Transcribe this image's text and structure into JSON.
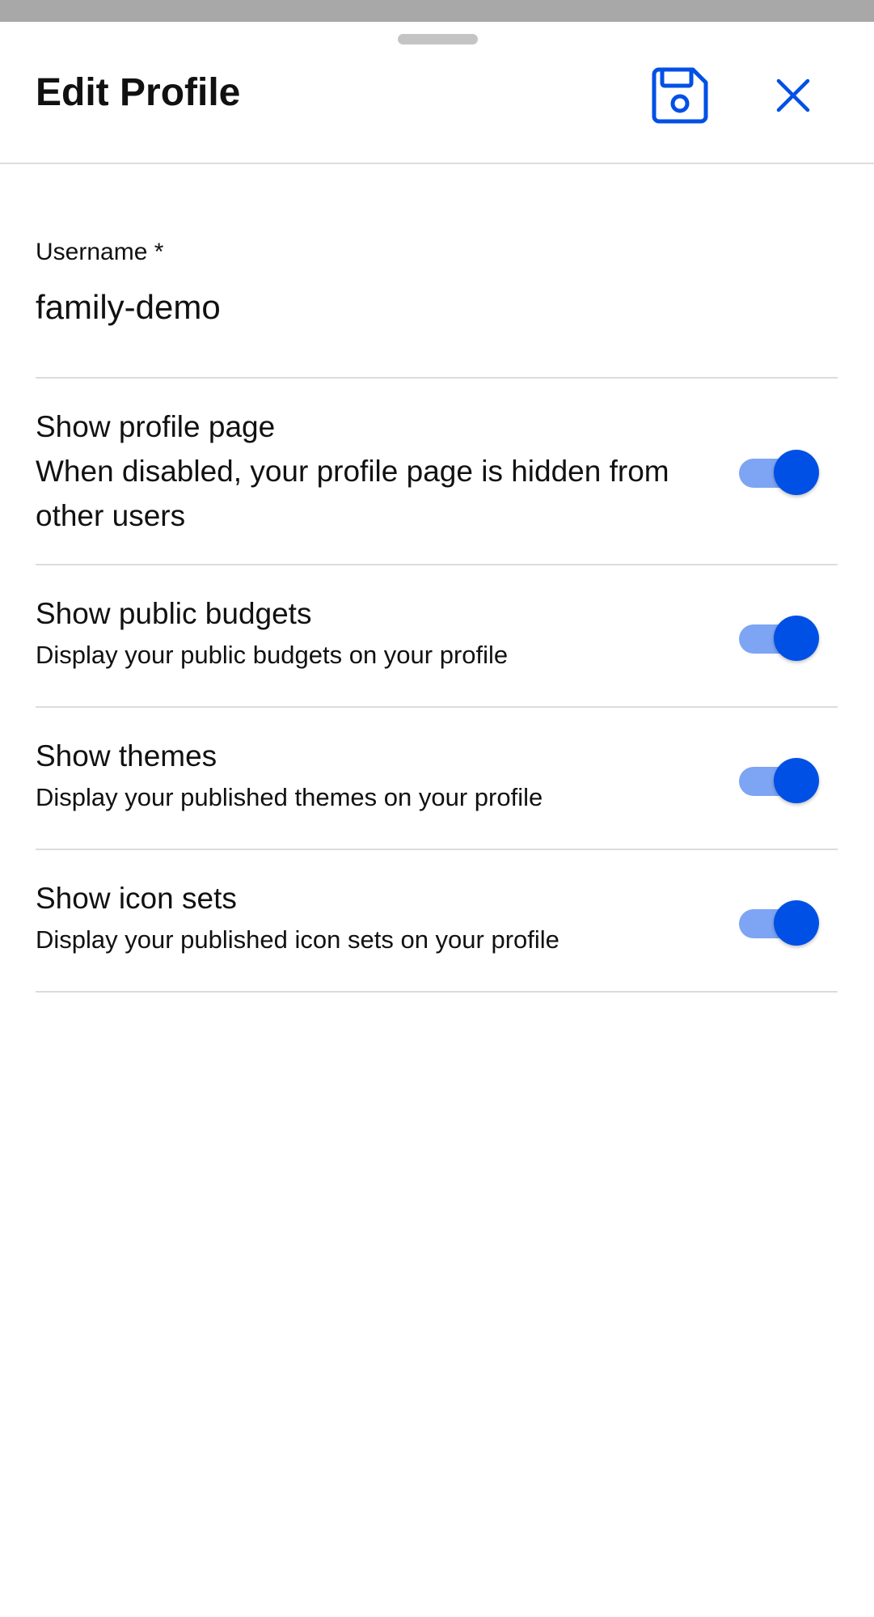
{
  "header": {
    "title": "Edit Profile",
    "save_icon": "save-icon",
    "close_icon": "close-icon"
  },
  "form": {
    "username_label": "Username *",
    "username_value": "family-demo"
  },
  "toggles": [
    {
      "title": "Show profile page",
      "description": "When disabled, your profile page is hidden from other users",
      "enabled": true
    },
    {
      "title": "Show public budgets",
      "description": "Display your public budgets on your profile",
      "enabled": true
    },
    {
      "title": "Show themes",
      "description": "Display your published themes on your profile",
      "enabled": true
    },
    {
      "title": "Show icon sets",
      "description": "Display your published icon sets on your profile",
      "enabled": true
    }
  ],
  "colors": {
    "accent": "#0050e6",
    "track": "#7ea4f4",
    "divider": "#dcdcdc"
  }
}
